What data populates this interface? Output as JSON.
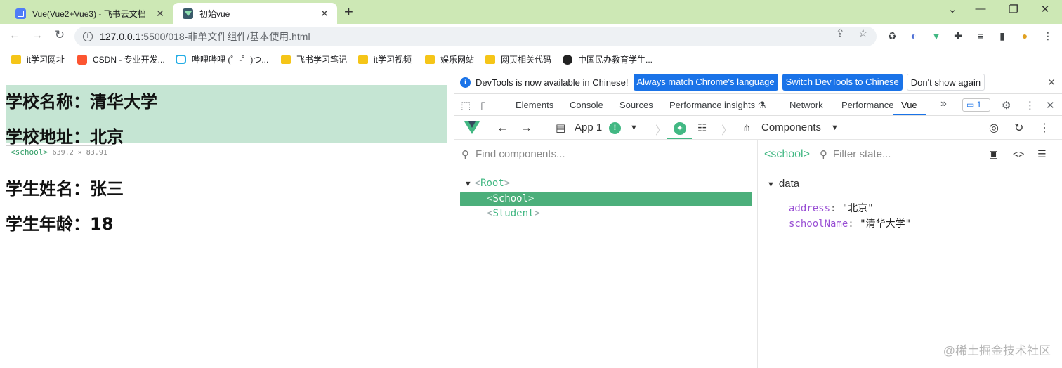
{
  "browser": {
    "tabs": [
      {
        "title": "Vue(Vue2+Vue3) - 飞书云文档",
        "active": false
      },
      {
        "title": "初始vue",
        "active": true
      }
    ],
    "new_tab_icon": "+",
    "window_controls": {
      "minimize": "⌄",
      "restore": "—",
      "maximize": "❐",
      "close": "✕"
    },
    "url_host": "127.0.0.1",
    "url_rest": ":5500/018-非单文件组件/基本使用.html",
    "bookmarks": [
      {
        "label": "it学习网址",
        "icon": "folder-icon"
      },
      {
        "label": "CSDN - 专业开发...",
        "icon": "csdn-icon"
      },
      {
        "label": "哔哩哔哩 (゜-゜)つ...",
        "icon": "bilibili-icon"
      },
      {
        "label": "飞书学习笔记",
        "icon": "folder-icon"
      },
      {
        "label": "it学习视频",
        "icon": "folder-icon"
      },
      {
        "label": "娱乐网站",
        "icon": "folder-icon"
      },
      {
        "label": "网页相关代码",
        "icon": "folder-icon"
      },
      {
        "label": "中国民办教育学生...",
        "icon": "globe-icon"
      }
    ]
  },
  "page": {
    "school_name": "学校名称：清华大学",
    "school_address": "学校地址：北京",
    "student_name": "学生姓名：张三",
    "student_age": "学生年龄：18",
    "inspect_hint": {
      "tag": "<school>",
      "dims": "639.2 × 83.91"
    }
  },
  "devtools": {
    "infobar": {
      "message": "DevTools is now available in Chinese!",
      "match_button": "Always match Chrome's language",
      "switch_button": "Switch DevTools to Chinese",
      "dismiss_button": "Don't show again"
    },
    "tabs": [
      "Elements",
      "Console",
      "Sources",
      "Performance insights",
      "Network",
      "Performance",
      "Vue"
    ],
    "more_tabs": "»",
    "issues_count": "1",
    "vue": {
      "app_label": "App 1",
      "components_label": "Components",
      "find_placeholder": "Find components...",
      "tree": [
        {
          "label": "Root",
          "depth": 0,
          "expanded": true,
          "selected": false
        },
        {
          "label": "School",
          "depth": 1,
          "expanded": false,
          "selected": true
        },
        {
          "label": "Student",
          "depth": 1,
          "expanded": false,
          "selected": false
        }
      ],
      "selected_component": "<school>",
      "filter_placeholder": "Filter state...",
      "data_section": "data",
      "data": [
        {
          "key": "address",
          "value": "\"北京\""
        },
        {
          "key": "schoolName",
          "value": "\"清华大学\""
        }
      ]
    }
  },
  "watermark": "@稀土掘金技术社区",
  "colors": {
    "vue_green": "#42b883",
    "selected_row": "#4caf7b",
    "tabstrip": "#cde8b5",
    "highlight": "#c5e5d3",
    "chrome_blue": "#1a73e8"
  }
}
